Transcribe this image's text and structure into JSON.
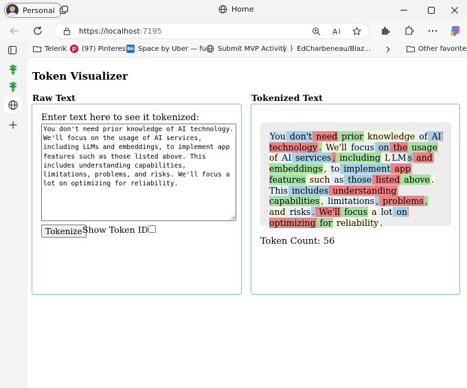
{
  "browser": {
    "profile_label": "Personal",
    "tab_title": "Home",
    "url_host": "https://localhost",
    "url_port": ":7195"
  },
  "favorites": [
    {
      "label": "Telerik",
      "icon": "folder-icon",
      "color": "#d8a23a"
    },
    {
      "label": "(97) Pinterest",
      "icon": "pinterest-icon",
      "color": "#e60023"
    },
    {
      "label": "Space by Uber — fu...",
      "icon": "behance-icon",
      "color": "#1769ff"
    },
    {
      "label": "Submit MVP Activity",
      "icon": "globe-icon",
      "color": "#555555"
    },
    {
      "label": "EdCharbeneau/Blaz...",
      "icon": "braces-icon",
      "color": "#333333"
    },
    {
      "label": "Other favorites",
      "icon": "folder-icon",
      "color": "#d8a23a"
    }
  ],
  "page": {
    "title": "Token Visualizer",
    "raw": {
      "heading": "Raw Text",
      "label": "Enter text here to see it tokenized:",
      "text": "You don't need prior knowledge of AI technology. We'll focus on the usage of AI services, including LLMs and embeddings, to implement app features such as those listed above. This includes understanding capabilities, limitations, problems, and risks. We'll focus a lot on optimizing for reliability.",
      "tokenize_button": "Tokenize",
      "show_ids_label": "Show Token IDs"
    },
    "tokenized": {
      "heading": "Tokenized Text",
      "token_count_label": "Token Count: 56",
      "tokens": [
        {
          "t": "You",
          "c": "#cde6f5"
        },
        {
          "t": " don't",
          "c": "#a6cfe3"
        },
        {
          "t": " need",
          "c": "#f08080"
        },
        {
          "t": " prior",
          "c": "#a4e2a0"
        },
        {
          "t": " knowledge",
          "c": "#fdf8dd"
        },
        {
          "t": " of",
          "c": "#e3f1fb"
        },
        {
          "t": " AI",
          "c": "#a6cfe3"
        },
        {
          "t": " technology",
          "c": "#f08080"
        },
        {
          "t": ".",
          "c": "#a4e2a0"
        },
        {
          "t": " We'll",
          "c": "#fdf8dd"
        },
        {
          "t": " focus",
          "c": "#e3f1fb"
        },
        {
          "t": " on",
          "c": "#a6cfe3"
        },
        {
          "t": " the",
          "c": "#f08080"
        },
        {
          "t": " usage",
          "c": "#a4e2a0"
        },
        {
          "t": " of",
          "c": "#fdf8dd"
        },
        {
          "t": " AI",
          "c": "#e3f1fb"
        },
        {
          "t": " services",
          "c": "#a6cfe3"
        },
        {
          "t": ",",
          "c": "#f08080"
        },
        {
          "t": " including",
          "c": "#a4e2a0"
        },
        {
          "t": " L",
          "c": "#fdf8dd"
        },
        {
          "t": "LM",
          "c": "#e3f1fb"
        },
        {
          "t": "s",
          "c": "#a6cfe3"
        },
        {
          "t": " and",
          "c": "#f08080"
        },
        {
          "t": " embeddings",
          "c": "#a4e2a0"
        },
        {
          "t": ",",
          "c": "#fdf8dd"
        },
        {
          "t": " to",
          "c": "#e3f1fb"
        },
        {
          "t": " implement",
          "c": "#a6cfe3"
        },
        {
          "t": " app",
          "c": "#f08080"
        },
        {
          "t": " features",
          "c": "#a4e2a0"
        },
        {
          "t": " such",
          "c": "#fdf8dd"
        },
        {
          "t": " as",
          "c": "#e3f1fb"
        },
        {
          "t": " those",
          "c": "#a6cfe3"
        },
        {
          "t": " listed",
          "c": "#f08080"
        },
        {
          "t": " above",
          "c": "#a4e2a0"
        },
        {
          "t": ".",
          "c": "#fdf8dd"
        },
        {
          "t": " This",
          "c": "#e3f1fb"
        },
        {
          "t": " includes",
          "c": "#a6cfe3"
        },
        {
          "t": " understanding",
          "c": "#f08080"
        },
        {
          "t": " capabilities",
          "c": "#a4e2a0"
        },
        {
          "t": ",",
          "c": "#fdf8dd"
        },
        {
          "t": " limitations",
          "c": "#e3f1fb"
        },
        {
          "t": ",",
          "c": "#a6cfe3"
        },
        {
          "t": " problems",
          "c": "#f08080"
        },
        {
          "t": ",",
          "c": "#a4e2a0"
        },
        {
          "t": " and",
          "c": "#fdf8dd"
        },
        {
          "t": " risks",
          "c": "#e3f1fb"
        },
        {
          "t": ".",
          "c": "#a6cfe3"
        },
        {
          "t": " We'll",
          "c": "#f08080"
        },
        {
          "t": " focus",
          "c": "#a4e2a0"
        },
        {
          "t": " a",
          "c": "#fdf8dd"
        },
        {
          "t": " lot",
          "c": "#e3f1fb"
        },
        {
          "t": " on",
          "c": "#a6cfe3"
        },
        {
          "t": " optimizing",
          "c": "#f08080"
        },
        {
          "t": " for",
          "c": "#a4e2a0"
        },
        {
          "t": " reliability",
          "c": "#fdf8dd"
        },
        {
          "t": ".",
          "c": "#e3f1fb"
        }
      ]
    }
  }
}
